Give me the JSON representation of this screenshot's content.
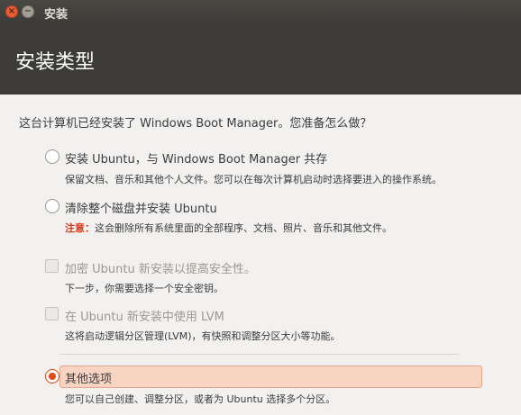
{
  "window": {
    "title": "安装"
  },
  "header": {
    "title": "安装类型"
  },
  "question": "这台计算机已经安装了 Windows Boot Manager。您准备怎么做？",
  "options": [
    {
      "label": "安装 Ubuntu，与 Windows Boot Manager 共存",
      "desc": "保留文档、音乐和其他个人文件。您可以在每次计算机启动时选择要进入的操作系统。"
    },
    {
      "label": "清除整个磁盘并安装 Ubuntu",
      "warn_prefix": "注意：",
      "desc": "这会删除所有系统里面的全部程序、文档、照片、音乐和其他文件。"
    }
  ],
  "checkboxes": [
    {
      "label": "加密 Ubuntu 新安装以提高安全性。",
      "desc": "下一步，你需要选择一个安全密钥。"
    },
    {
      "label": "在 Ubuntu 新安装中使用 LVM",
      "desc": "这将启动逻辑分区管理(LVM)，有快照和调整分区大小等功能。"
    }
  ],
  "other": {
    "label": "其他选项",
    "desc": "您可以自己创建、调整分区，或者为 Ubuntu 选择多个分区。"
  },
  "colors": {
    "accent": "#df4a16",
    "header_bg": "#3c3b37",
    "selected_bg": "#f9d4c3"
  }
}
